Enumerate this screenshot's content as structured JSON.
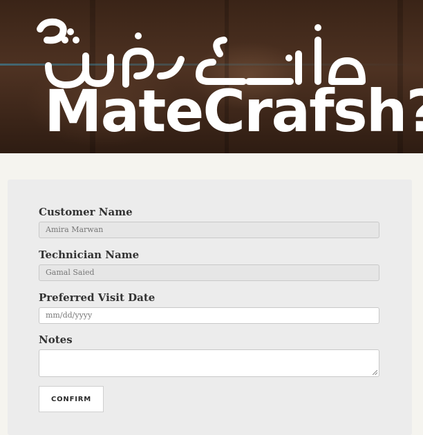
{
  "banner": {
    "logo_arabic": "ماتـ عرفش",
    "logo_latin": "MateCrafsh?"
  },
  "form": {
    "customer_name_label": "Customer Name",
    "customer_name_value": "Amira Marwan",
    "technician_name_label": "Technician Name",
    "technician_name_value": "Gamal Saied",
    "visit_date_label": "Preferred Visit Date",
    "visit_date_placeholder": "mm/dd/yyyy",
    "notes_label": "Notes",
    "notes_value": "",
    "confirm_label": "CONFIRM"
  },
  "colors": {
    "page_background": "#f5f4ef",
    "card_background": "#ececec",
    "label_text": "#333333",
    "banner_wood": "#4e3222"
  }
}
